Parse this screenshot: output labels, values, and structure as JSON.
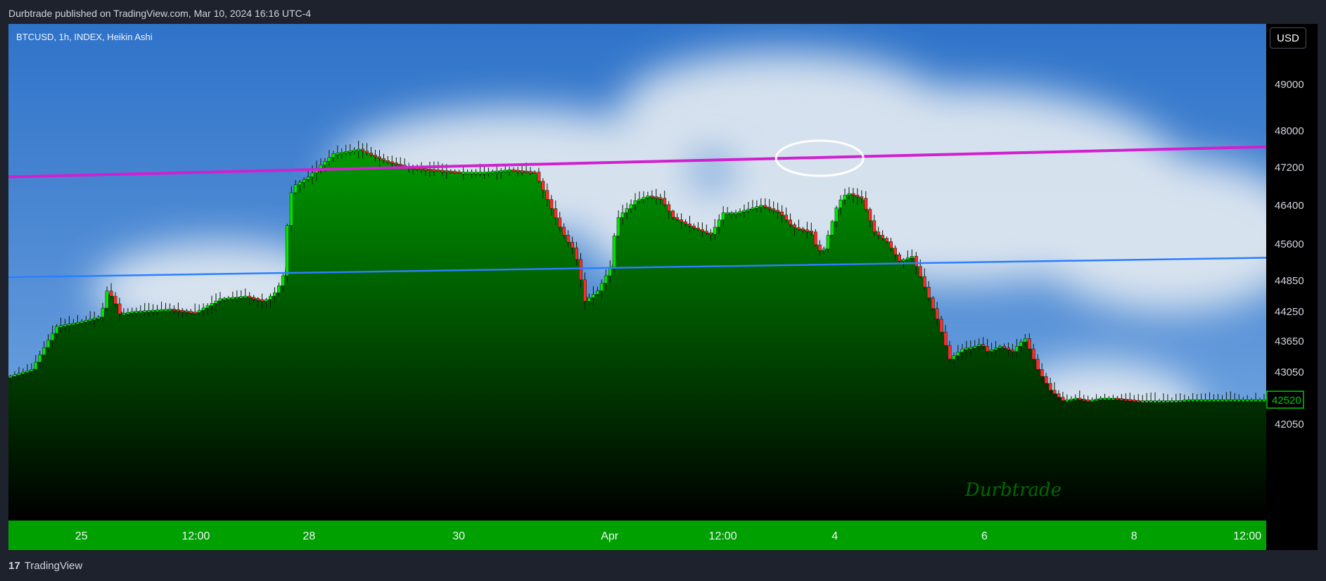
{
  "header": {
    "publisher_line": "Durbtrade published on TradingView.com, Mar 10, 2024 16:16 UTC-4"
  },
  "symbol_label": "BTCUSD, 1h, INDEX, Heikin Ashi",
  "currency_button": "USD",
  "watermark": "Durbtrade",
  "footer": {
    "logo_glyph": "17",
    "brand": "TradingView"
  },
  "colors": {
    "up": "#00e600",
    "down": "#ff2a2a",
    "area_top": "#009a00",
    "area_bottom": "#000000",
    "axis_bg": "#00a000",
    "resistance_line": "#d020d0",
    "support_line": "#2a7fff",
    "last_price_bg": "#00c800",
    "highlight_ellipse": "#ffffff"
  },
  "chart_data": {
    "type": "area",
    "style": "Heikin Ashi candlesticks over filled area",
    "price_axis": {
      "ticks": [
        49000,
        48000,
        47200,
        46400,
        45600,
        44850,
        44250,
        43650,
        43050,
        42050
      ],
      "last_price": 42520
    },
    "time_axis": {
      "labels": [
        "25",
        "12:00",
        "28",
        "30",
        "Apr",
        "12:00",
        "4",
        "6",
        "8",
        "12:00"
      ],
      "label_fractions": [
        0.058,
        0.149,
        0.239,
        0.358,
        0.478,
        0.568,
        0.657,
        0.776,
        0.895,
        0.985
      ]
    },
    "series": {
      "x_fraction": [
        0,
        0.02,
        0.04,
        0.06,
        0.075,
        0.08,
        0.085,
        0.09,
        0.1,
        0.13,
        0.15,
        0.17,
        0.19,
        0.205,
        0.215,
        0.22,
        0.225,
        0.228,
        0.24,
        0.26,
        0.28,
        0.3,
        0.32,
        0.34,
        0.36,
        0.38,
        0.4,
        0.42,
        0.44,
        0.445,
        0.452,
        0.46,
        0.47,
        0.48,
        0.485,
        0.49,
        0.5,
        0.51,
        0.52,
        0.53,
        0.545,
        0.56,
        0.57,
        0.58,
        0.6,
        0.615,
        0.625,
        0.64,
        0.645,
        0.65,
        0.66,
        0.665,
        0.67,
        0.68,
        0.69,
        0.7,
        0.71,
        0.715,
        0.72,
        0.74,
        0.75,
        0.76,
        0.77,
        0.775,
        0.78,
        0.79,
        0.8,
        0.805,
        0.81,
        0.82,
        0.83,
        0.84,
        0.85,
        0.86,
        0.87,
        0.88,
        0.9,
        0.91,
        0.92,
        0.93,
        0.94,
        0.955,
        0.96,
        0.97,
        0.98,
        0.99,
        1
      ],
      "price": [
        42950,
        43100,
        43950,
        44050,
        44150,
        44650,
        44500,
        44200,
        44250,
        44300,
        44230,
        44500,
        44550,
        44450,
        44650,
        44950,
        46500,
        46800,
        47000,
        47500,
        47600,
        47350,
        47200,
        47150,
        47100,
        47100,
        47150,
        47100,
        45950,
        45700,
        45450,
        44450,
        44650,
        45100,
        46100,
        46250,
        46500,
        46600,
        46550,
        46150,
        45950,
        45800,
        46250,
        46250,
        46400,
        46250,
        45950,
        45850,
        45450,
        45500,
        46350,
        46600,
        46650,
        46550,
        45850,
        45650,
        45250,
        45300,
        45350,
        44100,
        43300,
        43500,
        43550,
        43600,
        43450,
        43550,
        43450,
        43600,
        43700,
        43100,
        42700,
        42500,
        42550,
        42500,
        42550,
        42550,
        42500,
        42500,
        42500,
        42500,
        42520,
        42520,
        42520,
        42520,
        42520,
        42520,
        42520
      ]
    },
    "trendlines": [
      {
        "name": "resistance",
        "from": [
          0,
          47000
        ],
        "to": [
          1,
          47650
        ]
      },
      {
        "name": "support",
        "from": [
          0,
          44920
        ],
        "to": [
          1,
          45320
        ]
      }
    ],
    "highlight": {
      "x_fraction": 0.645,
      "price": 47400
    }
  }
}
